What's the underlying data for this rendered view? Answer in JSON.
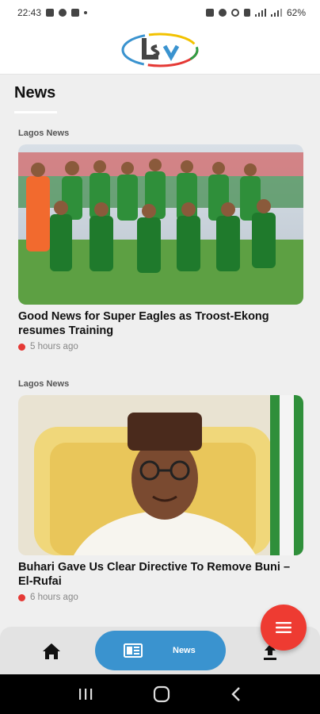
{
  "status_bar": {
    "time": "22:43",
    "battery": "62%"
  },
  "page": {
    "title": "News"
  },
  "articles": [
    {
      "category": "Lagos News",
      "headline": "Good News for Super Eagles as Troost-Ekong resumes Training",
      "time_ago": "5 hours ago",
      "image": "team-photo"
    },
    {
      "category": "Lagos News",
      "headline": "Buhari Gave Us Clear Directive To Remove Buni – El-Rufai",
      "time_ago": "6 hours ago",
      "image": "portrait-photo"
    }
  ],
  "bottom_nav": {
    "active_label": "News",
    "items": [
      "home-icon",
      "news-icon",
      "upload-icon"
    ]
  },
  "colors": {
    "accent_red": "#ee3b32",
    "nav_blue": "#3a93cf",
    "dot_red": "#e53935"
  }
}
